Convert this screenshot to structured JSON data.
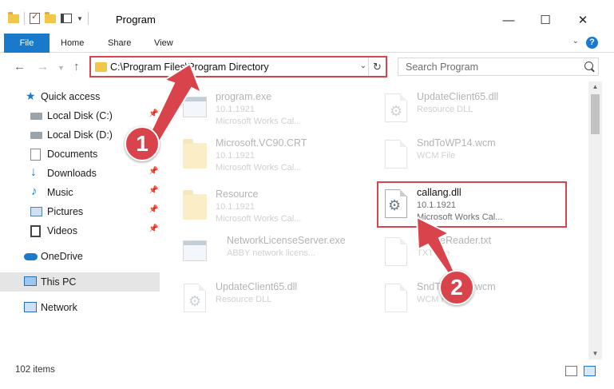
{
  "window": {
    "title": "Program",
    "minimize": "—",
    "maximize": "☐",
    "close": "✕"
  },
  "ribbon": {
    "file": "File",
    "home": "Home",
    "share": "Share",
    "view": "View",
    "help": "?"
  },
  "address": {
    "path": "C:\\Program Files\\Program Directory"
  },
  "search": {
    "placeholder": "Search Program"
  },
  "nav": {
    "items": [
      {
        "label": "Quick access"
      },
      {
        "label": "Local Disk (C:)"
      },
      {
        "label": "Local Disk (D:)"
      },
      {
        "label": "Documents"
      },
      {
        "label": "Downloads"
      },
      {
        "label": "Music"
      },
      {
        "label": "Pictures"
      },
      {
        "label": "Videos"
      },
      {
        "label": "OneDrive"
      },
      {
        "label": "This PC"
      },
      {
        "label": "Network"
      }
    ]
  },
  "files": [
    {
      "name": "program.exe",
      "version": "10.1.1921",
      "desc": "Microsoft Works Cal..."
    },
    {
      "name": "UpdateClient65.dll",
      "version": "Resource DLL",
      "desc": ""
    },
    {
      "name": "Microsoft.VC90.CRT",
      "version": "10.1.1921",
      "desc": "Microsoft Works Cal..."
    },
    {
      "name": "SndToWP14.wcm",
      "version": "WCM File",
      "desc": ""
    },
    {
      "name": "Resource",
      "version": "10.1.1921",
      "desc": "Microsoft Works Cal..."
    },
    {
      "name": "callang.dll",
      "version": "10.1.1921",
      "desc": "Microsoft Works Cal..."
    },
    {
      "name": "NetworkLicenseServer.exe",
      "version": "ABBY network licens...",
      "desc": ""
    },
    {
      "name": "RefineReader.txt",
      "version": "TXT File",
      "desc": ""
    },
    {
      "name": "UpdateClient65.dll",
      "version": "Resource DLL",
      "desc": ""
    },
    {
      "name": "SndToWP14.wcm",
      "version": "WCM File",
      "desc": ""
    }
  ],
  "status": {
    "count": "102 items"
  },
  "callouts": {
    "one": "1",
    "two": "2"
  },
  "colors": {
    "accent": "#1979ca",
    "annotation": "#d9434b"
  }
}
